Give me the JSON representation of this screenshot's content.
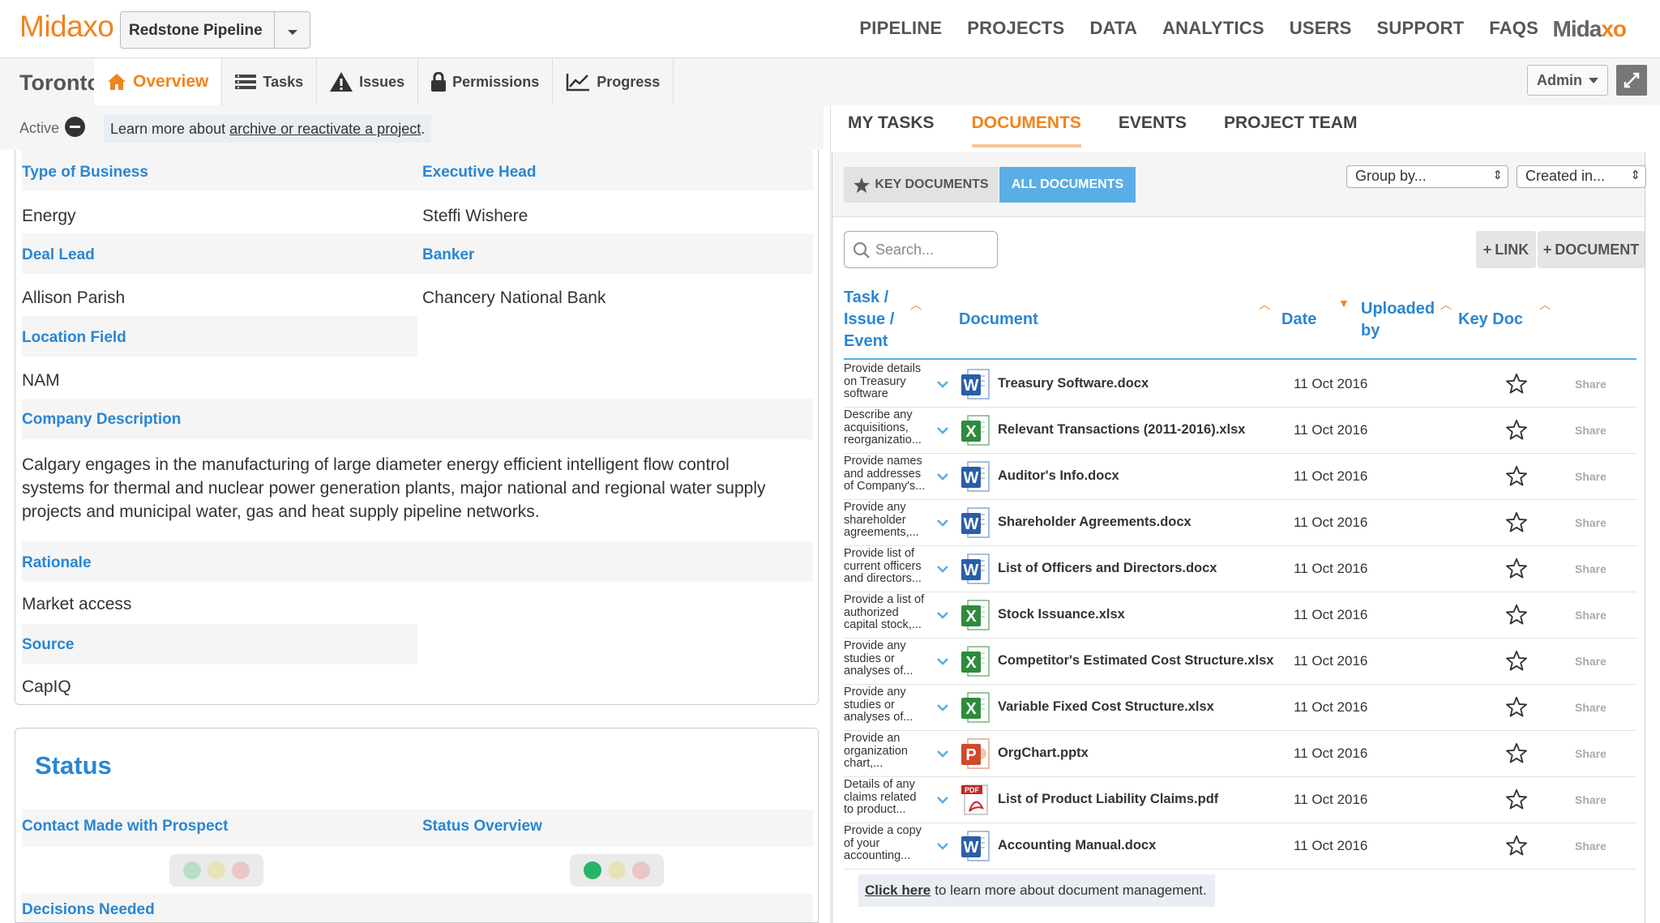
{
  "app": {
    "logo": "Midaxo",
    "logo_right_a": "Mida",
    "logo_right_b": "xo",
    "pipeline_select": "Redstone Pipeline"
  },
  "mainnav": [
    "PIPELINE",
    "PROJECTS",
    "DATA",
    "ANALYTICS",
    "USERS",
    "SUPPORT",
    "FAQS"
  ],
  "project": {
    "name": "Toronto",
    "tabs": [
      "Overview",
      "Tasks",
      "Issues",
      "Permissions",
      "Progress"
    ],
    "active_tab": "Overview",
    "status_label": "Active",
    "learn_prefix": "Learn more about",
    "learn_link": "archive or reactivate a project",
    "learn_suffix": "."
  },
  "admin": {
    "label": "Admin"
  },
  "fields": {
    "type_of_business": {
      "label": "Type of Business",
      "value": "Energy"
    },
    "executive_head": {
      "label": "Executive Head",
      "value": "Steffi Wishere"
    },
    "deal_lead": {
      "label": "Deal Lead",
      "value": "Allison Parish"
    },
    "banker": {
      "label": "Banker",
      "value": "Chancery National Bank"
    },
    "location": {
      "label": "Location Field",
      "value": "NAM"
    },
    "company_description": {
      "label": "Company Description",
      "lines": [
        "Calgary engages in the manufacturing of large diameter energy efficient intelligent flow control",
        "systems for thermal and nuclear power generation plants, major national and regional water supply",
        "projects and municipal water, gas and heat supply pipeline networks."
      ]
    },
    "rationale": {
      "label": "Rationale",
      "value": "Market access"
    },
    "source": {
      "label": "Source",
      "value": "CapIQ"
    }
  },
  "status_section": {
    "title": "Status",
    "contact_made": "Contact Made with Prospect",
    "status_overview": "Status Overview",
    "decisions_needed": "Decisions Needed",
    "colors": {
      "green": "#27b466",
      "muted_green": "#b8ddc9",
      "muted_yellow": "#e8e2b8",
      "muted_red": "#ecc6c6"
    }
  },
  "right": {
    "tabs": [
      "MY TASKS",
      "DOCUMENTS",
      "EVENTS",
      "PROJECT TEAM"
    ],
    "active_tab": "DOCUMENTS",
    "key_documents": "KEY DOCUMENTS",
    "all_documents": "ALL DOCUMENTS",
    "group_by": "Group by...",
    "created_in": "Created in...",
    "search_placeholder": "Search...",
    "link_btn": "LINK",
    "document_btn": "DOCUMENT",
    "columns": {
      "task_1": "Task /",
      "task_2": "Issue /",
      "task_3": "Event",
      "document": "Document",
      "date": "Date",
      "uploaded_1": "Uploaded",
      "uploaded_2": "by",
      "key_doc": "Key Doc"
    },
    "documents": [
      {
        "task": [
          "Provide details",
          "on Treasury",
          "software"
        ],
        "name": "Treasury Software.docx",
        "type": "word",
        "date": "11 Oct 2016",
        "share": "Share"
      },
      {
        "task": [
          "Describe any",
          "acquisitions,",
          "reorganizatio..."
        ],
        "name": "Relevant Transactions (2011-2016).xlsx",
        "type": "excel",
        "date": "11 Oct 2016",
        "share": "Share"
      },
      {
        "task": [
          "Provide names",
          "and addresses",
          "of Company's..."
        ],
        "name": "Auditor's Info.docx",
        "type": "word",
        "date": "11 Oct 2016",
        "share": "Share"
      },
      {
        "task": [
          "Provide any",
          "shareholder",
          "agreements,..."
        ],
        "name": "Shareholder Agreements.docx",
        "type": "word",
        "date": "11 Oct 2016",
        "share": "Share"
      },
      {
        "task": [
          "Provide list of",
          "current officers",
          "and directors..."
        ],
        "name": "List of Officers and Directors.docx",
        "type": "word",
        "date": "11 Oct 2016",
        "share": "Share"
      },
      {
        "task": [
          "Provide a list of",
          "authorized",
          "capital stock,..."
        ],
        "name": "Stock Issuance.xlsx",
        "type": "excel",
        "date": "11 Oct 2016",
        "share": "Share"
      },
      {
        "task": [
          "Provide any",
          "studies or",
          "analyses of..."
        ],
        "name": "Competitor's Estimated Cost Structure.xlsx",
        "type": "excel",
        "date": "11 Oct 2016",
        "share": "Share"
      },
      {
        "task": [
          "Provide any",
          "studies or",
          "analyses of..."
        ],
        "name": "Variable Fixed Cost Structure.xlsx",
        "type": "excel",
        "date": "11 Oct 2016",
        "share": "Share"
      },
      {
        "task": [
          "Provide an",
          "organization",
          "chart,..."
        ],
        "name": "OrgChart.pptx",
        "type": "ppt",
        "date": "11 Oct 2016",
        "share": "Share"
      },
      {
        "task": [
          "Details of any",
          "claims related",
          "to product..."
        ],
        "name": "List of Product Liability Claims.pdf",
        "type": "pdf",
        "date": "11 Oct 2016",
        "share": "Share"
      },
      {
        "task": [
          "Provide a copy",
          "of your",
          "accounting..."
        ],
        "name": "Accounting Manual.docx",
        "type": "word",
        "date": "11 Oct 2016",
        "share": "Share"
      }
    ],
    "footer_link": "Click here",
    "footer_text": "to learn more about document management."
  },
  "colors": {
    "brand_orange": "#f0831e",
    "label_blue": "#2a86d2",
    "button_blue": "#5aaee5"
  }
}
